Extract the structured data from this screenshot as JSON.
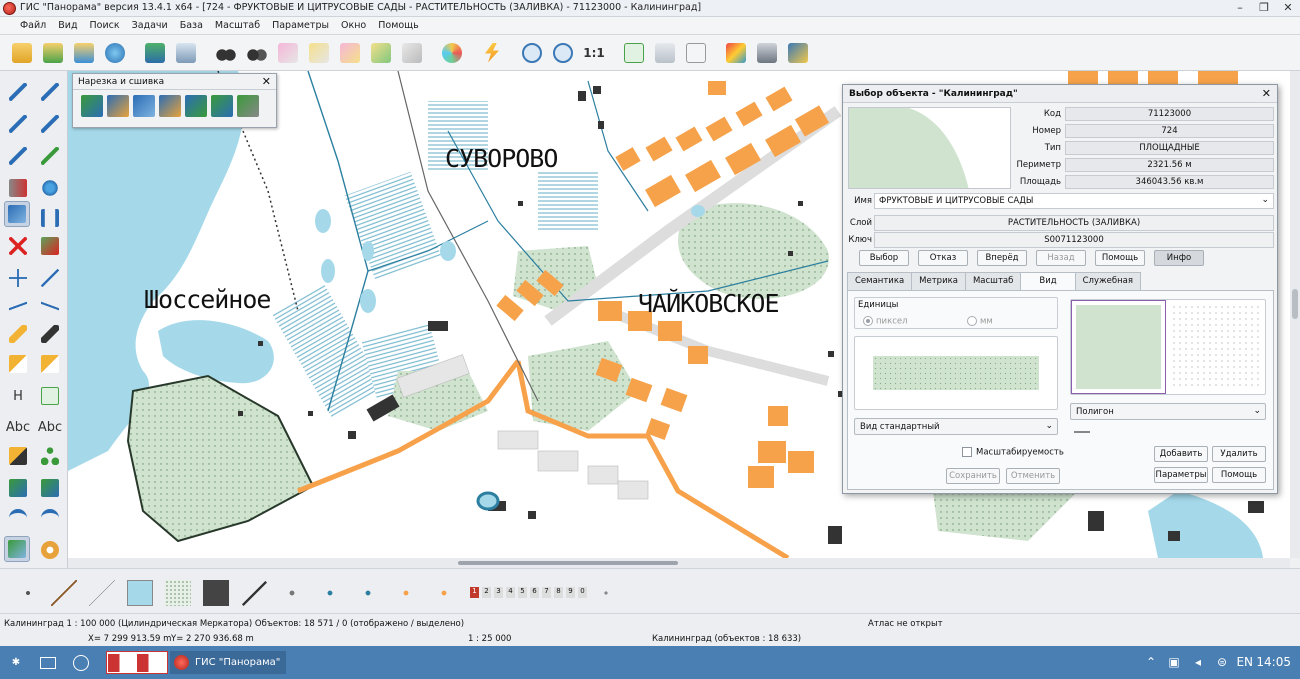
{
  "window": {
    "title": "ГИС \"Панорама\" версия 13.4.1 x64 - [724 - ФРУКТОВЫЕ И ЦИТРУСОВЫЕ САДЫ - РАСТИТЕЛЬНОСТЬ (ЗАЛИВКА) - 71123000 - Калининград]",
    "controls": [
      "–",
      "❐",
      "✕"
    ]
  },
  "menu": [
    "Файл",
    "Вид",
    "Поиск",
    "Задачи",
    "База",
    "Масштаб",
    "Параметры",
    "Окно",
    "Помощь"
  ],
  "toolbar": {
    "scale_1_1": "1:1"
  },
  "left_tools": {
    "text_h": "H",
    "text_abc": "Abc",
    "text_abc2": "Abc"
  },
  "map": {
    "labels": {
      "suvorovo": "СУВОРОВО",
      "shosseynoe": "Шоссейное",
      "chaykovskoe": "ЧАЙКОВСКОЕ"
    }
  },
  "cut_panel": {
    "title": "Нарезка и сшивка",
    "close": "✕"
  },
  "dialog": {
    "title": "Выбор объекта - \"Калининград\"",
    "close": "✕",
    "fields": {
      "code_label": "Код",
      "code_value": "71123000",
      "number_label": "Номер",
      "number_value": "724",
      "type_label": "Тип",
      "type_value": "ПЛОЩАДНЫЕ",
      "perimeter_label": "Периметр",
      "perimeter_value": "2321.56  м",
      "area_label": "Площадь",
      "area_value": "346043.56  кв.м",
      "name_label": "Имя",
      "name_value": "ФРУКТОВЫЕ И ЦИТРУСОВЫЕ САДЫ",
      "layer_label": "Слой",
      "layer_value": "РАСТИТЕЛЬНОСТЬ (ЗАЛИВКА)",
      "key_label": "Ключ",
      "key_value": "S0071123000"
    },
    "buttons": {
      "select": "Выбор",
      "cancel": "Отказ",
      "forward": "Вперёд",
      "back": "Назад",
      "help": "Помощь",
      "info": "Инфо"
    },
    "tabs": [
      "Семантика",
      "Метрика",
      "Масштаб",
      "Вид",
      "Служебная"
    ],
    "view_tab": {
      "units_label": "Единицы",
      "unit_pixel": "пиксел",
      "unit_mm": "мм",
      "style_select": "Вид стандартный",
      "scalable": "Масштабируемость",
      "save": "Сохранить",
      "cancel": "Отменить",
      "polygon_select": "Полигон",
      "add": "Добавить",
      "delete": "Удалить",
      "params": "Параметры",
      "help": "Помощь"
    }
  },
  "bottom_strip": {
    "layer_numbers": [
      "1",
      "2",
      "3",
      "4",
      "5",
      "6",
      "7",
      "8",
      "9",
      "0"
    ]
  },
  "status": {
    "map_info": "Калининград   1 : 100 000 (Цилиндрическая Меркатора) Объектов: 18 571 / 0 (отображено / выделено)",
    "atlas": "Атлас не открыт",
    "x_coord": "X= 7 299 913.59 m",
    "y_coord": "Y= 2 270 936.68 m",
    "scale": "1 : 25 000",
    "objects": "Калининград   (объектов : 18 633)"
  },
  "taskbar": {
    "app_label": "ГИС \"Панорама\"",
    "lang": "EN",
    "time": "14:05"
  },
  "colors": {
    "water": "#a5d9ea",
    "orange": "#f6a24a",
    "green": "#cfe3cf",
    "accent": "#4a7fb3"
  }
}
